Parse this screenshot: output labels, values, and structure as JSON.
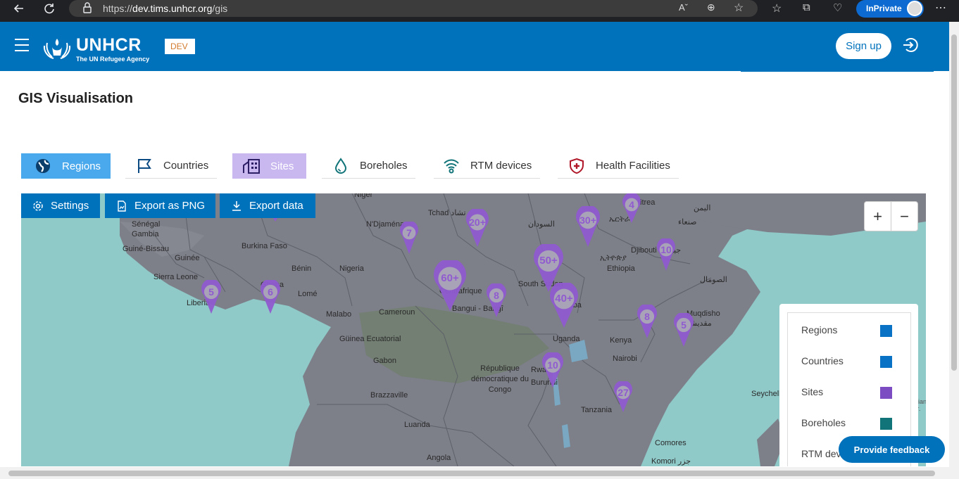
{
  "browser": {
    "url_prefix": "https://",
    "url_host": "dev.tims.unhcr.org",
    "url_path": "/gis",
    "inprivate_label": "InPrivate"
  },
  "header": {
    "logo_name": "UNHCR",
    "logo_tagline": "The UN Refugee Agency",
    "env_badge": "DEV",
    "signup_label": "Sign up",
    "brand_color": "#0072bc"
  },
  "page": {
    "title": "GIS Visualisation"
  },
  "tabs": [
    {
      "label": "Regions",
      "icon": "globe-icon",
      "active": true
    },
    {
      "label": "Countries",
      "icon": "flag-icon"
    },
    {
      "label": "Sites",
      "icon": "building-icon",
      "active": true
    },
    {
      "label": "Boreholes",
      "icon": "water-drop-icon"
    },
    {
      "label": "RTM devices",
      "icon": "wifi-icon"
    },
    {
      "label": "Health Facilities",
      "icon": "medical-shield-icon"
    }
  ],
  "map": {
    "toolbar": {
      "settings_label": "Settings",
      "export_png_label": "Export as PNG",
      "export_data_label": "Export data"
    },
    "zoom_in": "+",
    "zoom_out": "−",
    "labels": [
      "Niger",
      "Tchad تشاد",
      "السودان",
      "Eritrea",
      "ኤርትራ",
      "اليمن",
      "صنعاء",
      "Sénégal",
      "Gambia",
      "Guiné-Bissau",
      "N'Djaména",
      "Burkina Faso",
      "Guinée",
      "Bénin",
      "Nigeria",
      "Djibouti جيبوتي",
      "ኢትዮጵያ",
      "Ethiopia",
      "Sierra Leone",
      "Ghana",
      "Lomé",
      "Centrafrique",
      "Bangui - Bangî",
      "South Sudan",
      "Juba",
      "الصومال",
      "Liberia",
      "Malabo",
      "Cameroun",
      "Muqdisho مقديشو",
      "Güinea Ecuatorial",
      "Uganda",
      "Kenya",
      "Gabon",
      "Nairobi",
      "République démocratique du Congo",
      "Rwanda",
      "Burundi",
      "Seychelles",
      "British Indian Ocean Ter.",
      "Brazzaville",
      "Tanzania",
      "Luanda",
      "Comores",
      "Komori جزر",
      "Angola"
    ],
    "markers": [
      {
        "label": "",
        "big": true
      },
      {
        "label": "7"
      },
      {
        "label": "20+"
      },
      {
        "label": "30+"
      },
      {
        "label": "4"
      },
      {
        "label": "10"
      },
      {
        "label": "50+"
      },
      {
        "label": "60+"
      },
      {
        "label": "8"
      },
      {
        "label": "5"
      },
      {
        "label": "6"
      },
      {
        "label": "40+"
      },
      {
        "label": "8"
      },
      {
        "label": "5"
      },
      {
        "label": "10"
      },
      {
        "label": "27"
      }
    ],
    "legend": [
      {
        "label": "Regions",
        "color": "#0a72c4"
      },
      {
        "label": "Countries",
        "color": "#0a72c4"
      },
      {
        "label": "Sites",
        "color": "#7c4cc2"
      },
      {
        "label": "Boreholes",
        "color": "#117479"
      },
      {
        "label": "RTM devices",
        "color": "#117479"
      }
    ],
    "marker_color": "#8f5bcf"
  },
  "feedback_label": "Provide feedback"
}
